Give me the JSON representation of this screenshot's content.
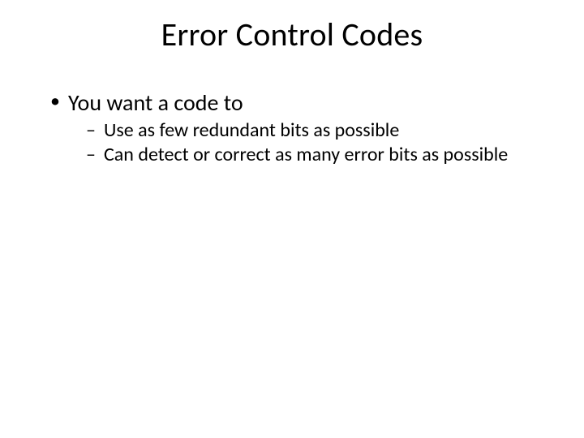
{
  "slide": {
    "title": "Error Control Codes",
    "bullets": [
      {
        "text": "You want a code to",
        "children": [
          "Use as few redundant bits as possible",
          "Can detect or correct as many error bits as possible"
        ]
      }
    ]
  }
}
